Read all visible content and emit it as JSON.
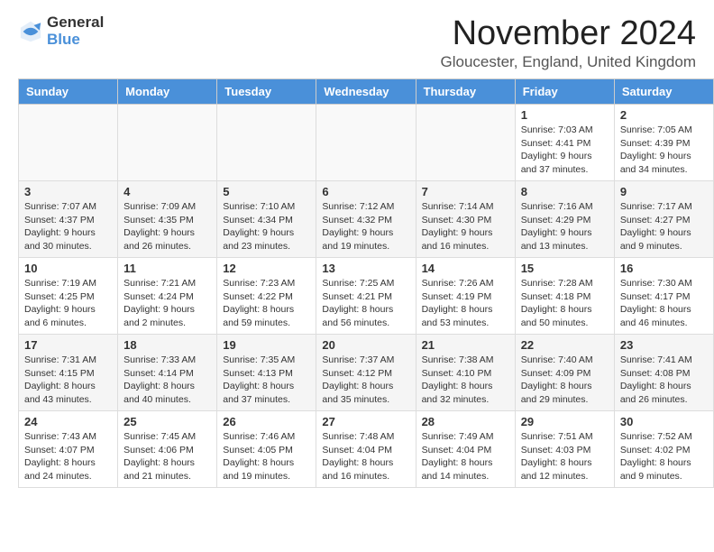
{
  "logo": {
    "general": "General",
    "blue": "Blue"
  },
  "header": {
    "month": "November 2024",
    "location": "Gloucester, England, United Kingdom"
  },
  "columns": [
    "Sunday",
    "Monday",
    "Tuesday",
    "Wednesday",
    "Thursday",
    "Friday",
    "Saturday"
  ],
  "weeks": [
    [
      {
        "day": "",
        "info": ""
      },
      {
        "day": "",
        "info": ""
      },
      {
        "day": "",
        "info": ""
      },
      {
        "day": "",
        "info": ""
      },
      {
        "day": "",
        "info": ""
      },
      {
        "day": "1",
        "info": "Sunrise: 7:03 AM\nSunset: 4:41 PM\nDaylight: 9 hours\nand 37 minutes."
      },
      {
        "day": "2",
        "info": "Sunrise: 7:05 AM\nSunset: 4:39 PM\nDaylight: 9 hours\nand 34 minutes."
      }
    ],
    [
      {
        "day": "3",
        "info": "Sunrise: 7:07 AM\nSunset: 4:37 PM\nDaylight: 9 hours\nand 30 minutes."
      },
      {
        "day": "4",
        "info": "Sunrise: 7:09 AM\nSunset: 4:35 PM\nDaylight: 9 hours\nand 26 minutes."
      },
      {
        "day": "5",
        "info": "Sunrise: 7:10 AM\nSunset: 4:34 PM\nDaylight: 9 hours\nand 23 minutes."
      },
      {
        "day": "6",
        "info": "Sunrise: 7:12 AM\nSunset: 4:32 PM\nDaylight: 9 hours\nand 19 minutes."
      },
      {
        "day": "7",
        "info": "Sunrise: 7:14 AM\nSunset: 4:30 PM\nDaylight: 9 hours\nand 16 minutes."
      },
      {
        "day": "8",
        "info": "Sunrise: 7:16 AM\nSunset: 4:29 PM\nDaylight: 9 hours\nand 13 minutes."
      },
      {
        "day": "9",
        "info": "Sunrise: 7:17 AM\nSunset: 4:27 PM\nDaylight: 9 hours\nand 9 minutes."
      }
    ],
    [
      {
        "day": "10",
        "info": "Sunrise: 7:19 AM\nSunset: 4:25 PM\nDaylight: 9 hours\nand 6 minutes."
      },
      {
        "day": "11",
        "info": "Sunrise: 7:21 AM\nSunset: 4:24 PM\nDaylight: 9 hours\nand 2 minutes."
      },
      {
        "day": "12",
        "info": "Sunrise: 7:23 AM\nSunset: 4:22 PM\nDaylight: 8 hours\nand 59 minutes."
      },
      {
        "day": "13",
        "info": "Sunrise: 7:25 AM\nSunset: 4:21 PM\nDaylight: 8 hours\nand 56 minutes."
      },
      {
        "day": "14",
        "info": "Sunrise: 7:26 AM\nSunset: 4:19 PM\nDaylight: 8 hours\nand 53 minutes."
      },
      {
        "day": "15",
        "info": "Sunrise: 7:28 AM\nSunset: 4:18 PM\nDaylight: 8 hours\nand 50 minutes."
      },
      {
        "day": "16",
        "info": "Sunrise: 7:30 AM\nSunset: 4:17 PM\nDaylight: 8 hours\nand 46 minutes."
      }
    ],
    [
      {
        "day": "17",
        "info": "Sunrise: 7:31 AM\nSunset: 4:15 PM\nDaylight: 8 hours\nand 43 minutes."
      },
      {
        "day": "18",
        "info": "Sunrise: 7:33 AM\nSunset: 4:14 PM\nDaylight: 8 hours\nand 40 minutes."
      },
      {
        "day": "19",
        "info": "Sunrise: 7:35 AM\nSunset: 4:13 PM\nDaylight: 8 hours\nand 37 minutes."
      },
      {
        "day": "20",
        "info": "Sunrise: 7:37 AM\nSunset: 4:12 PM\nDaylight: 8 hours\nand 35 minutes."
      },
      {
        "day": "21",
        "info": "Sunrise: 7:38 AM\nSunset: 4:10 PM\nDaylight: 8 hours\nand 32 minutes."
      },
      {
        "day": "22",
        "info": "Sunrise: 7:40 AM\nSunset: 4:09 PM\nDaylight: 8 hours\nand 29 minutes."
      },
      {
        "day": "23",
        "info": "Sunrise: 7:41 AM\nSunset: 4:08 PM\nDaylight: 8 hours\nand 26 minutes."
      }
    ],
    [
      {
        "day": "24",
        "info": "Sunrise: 7:43 AM\nSunset: 4:07 PM\nDaylight: 8 hours\nand 24 minutes."
      },
      {
        "day": "25",
        "info": "Sunrise: 7:45 AM\nSunset: 4:06 PM\nDaylight: 8 hours\nand 21 minutes."
      },
      {
        "day": "26",
        "info": "Sunrise: 7:46 AM\nSunset: 4:05 PM\nDaylight: 8 hours\nand 19 minutes."
      },
      {
        "day": "27",
        "info": "Sunrise: 7:48 AM\nSunset: 4:04 PM\nDaylight: 8 hours\nand 16 minutes."
      },
      {
        "day": "28",
        "info": "Sunrise: 7:49 AM\nSunset: 4:04 PM\nDaylight: 8 hours\nand 14 minutes."
      },
      {
        "day": "29",
        "info": "Sunrise: 7:51 AM\nSunset: 4:03 PM\nDaylight: 8 hours\nand 12 minutes."
      },
      {
        "day": "30",
        "info": "Sunrise: 7:52 AM\nSunset: 4:02 PM\nDaylight: 8 hours\nand 9 minutes."
      }
    ]
  ]
}
